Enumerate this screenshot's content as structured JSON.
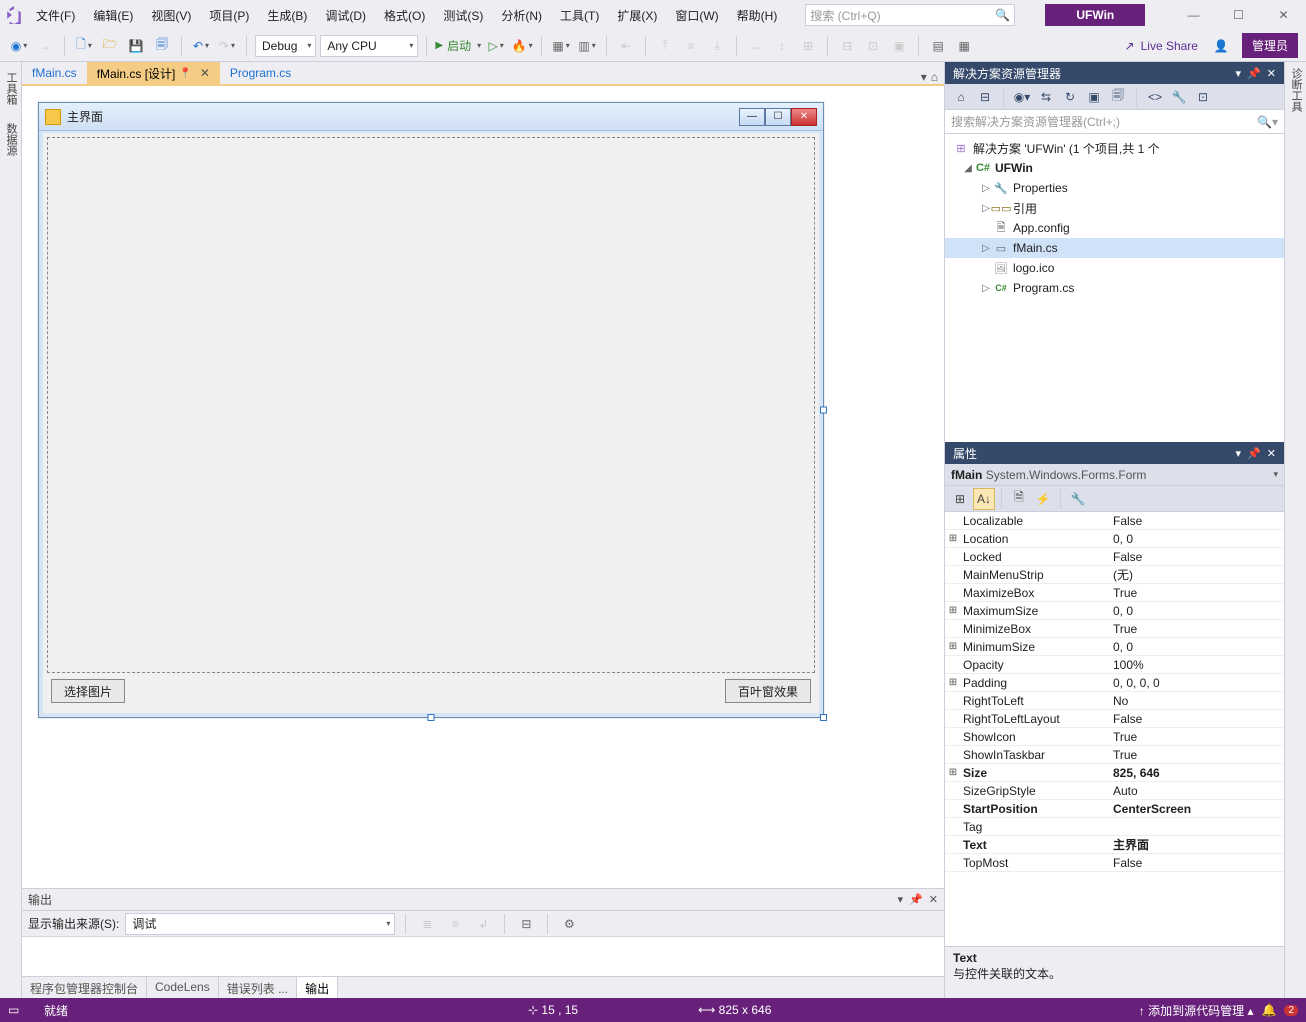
{
  "titlebar": {
    "menus": [
      "文件(F)",
      "编辑(E)",
      "视图(V)",
      "项目(P)",
      "生成(B)",
      "调试(D)",
      "格式(O)",
      "测试(S)",
      "分析(N)",
      "工具(T)",
      "扩展(X)",
      "窗口(W)",
      "帮助(H)"
    ],
    "search_placeholder": "搜索 (Ctrl+Q)",
    "app_title": "UFWin"
  },
  "window_buttons": {
    "min": "—",
    "max": "☐",
    "close": "✕"
  },
  "toolbar": {
    "config": "Debug",
    "platform": "Any CPU",
    "run_label": "启动",
    "liveshare": "Live Share",
    "admin": "管理员"
  },
  "left_tabs": [
    "工具箱",
    "数据源"
  ],
  "right_tab": "诊断工具",
  "doc_tabs": {
    "items": [
      {
        "label": "fMain.cs",
        "active": false
      },
      {
        "label": "fMain.cs [设计]",
        "active": true,
        "pin": true
      },
      {
        "label": "Program.cs",
        "active": false
      }
    ]
  },
  "form": {
    "title": "主界面",
    "btn_left": "选择图片",
    "btn_right": "百叶窗效果"
  },
  "output": {
    "title": "输出",
    "source_label": "显示输出来源(S):",
    "source_value": "调试",
    "bottom_tabs": [
      "程序包管理器控制台",
      "CodeLens",
      "错误列表 ...",
      "输出"
    ],
    "active_bottom": 3
  },
  "solution": {
    "title": "解决方案资源管理器",
    "search_placeholder": "搜索解决方案资源管理器(Ctrl+;)",
    "root": "解决方案 'UFWin' (1 个项目,共 1 个",
    "project": "UFWin",
    "nodes": {
      "properties": "Properties",
      "references": "引用",
      "appconfig": "App.config",
      "fmain": "fMain.cs",
      "logo": "logo.ico",
      "program": "Program.cs"
    }
  },
  "properties": {
    "title": "属性",
    "object": "fMain",
    "objtype": "System.Windows.Forms.Form",
    "rows": [
      {
        "exp": "",
        "name": "Localizable",
        "val": "False"
      },
      {
        "exp": "⊞",
        "name": "Location",
        "val": "0, 0"
      },
      {
        "exp": "",
        "name": "Locked",
        "val": "False"
      },
      {
        "exp": "",
        "name": "MainMenuStrip",
        "val": "(无)"
      },
      {
        "exp": "",
        "name": "MaximizeBox",
        "val": "True"
      },
      {
        "exp": "⊞",
        "name": "MaximumSize",
        "val": "0, 0"
      },
      {
        "exp": "",
        "name": "MinimizeBox",
        "val": "True"
      },
      {
        "exp": "⊞",
        "name": "MinimumSize",
        "val": "0, 0"
      },
      {
        "exp": "",
        "name": "Opacity",
        "val": "100%"
      },
      {
        "exp": "⊞",
        "name": "Padding",
        "val": "0, 0, 0, 0"
      },
      {
        "exp": "",
        "name": "RightToLeft",
        "val": "No"
      },
      {
        "exp": "",
        "name": "RightToLeftLayout",
        "val": "False"
      },
      {
        "exp": "",
        "name": "ShowIcon",
        "val": "True"
      },
      {
        "exp": "",
        "name": "ShowInTaskbar",
        "val": "True"
      },
      {
        "exp": "⊞",
        "name": "Size",
        "val": "825, 646",
        "bold": true
      },
      {
        "exp": "",
        "name": "SizeGripStyle",
        "val": "Auto"
      },
      {
        "exp": "",
        "name": "StartPosition",
        "val": "CenterScreen",
        "bold": true
      },
      {
        "exp": "",
        "name": "Tag",
        "val": ""
      },
      {
        "exp": "",
        "name": "Text",
        "val": "主界面",
        "bold": true
      },
      {
        "exp": "",
        "name": "TopMost",
        "val": "False"
      }
    ],
    "desc_title": "Text",
    "desc_body": "与控件关联的文本。"
  },
  "statusbar": {
    "ready": "就绪",
    "pos": "15 , 15",
    "size": "825 x 646",
    "scm": "添加到源代码管理",
    "badge": "2"
  }
}
